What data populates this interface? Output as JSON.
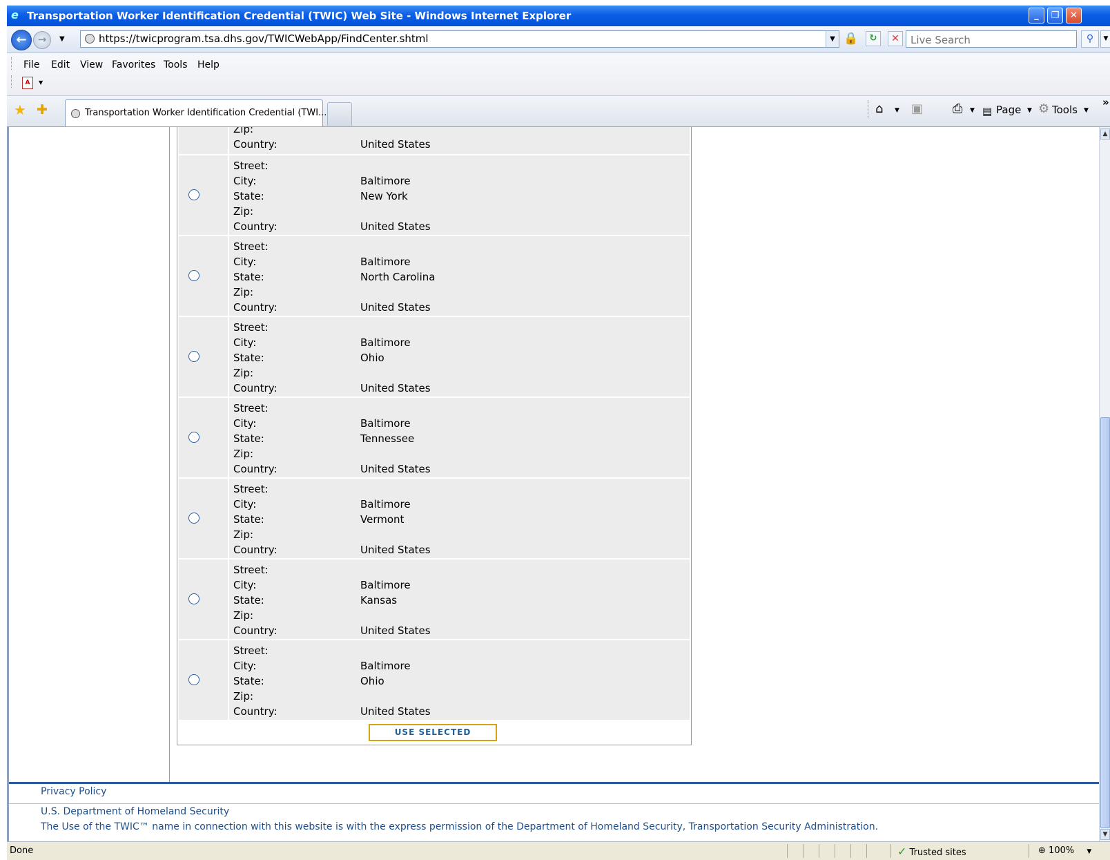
{
  "window": {
    "title": "Transportation Worker Identification Credential (TWIC) Web Site - Windows Internet Explorer"
  },
  "address_bar": {
    "url": "https://twicprogram.tsa.dhs.gov/TWICWebApp/FindCenter.shtml",
    "search_placeholder": "Live Search"
  },
  "menu": [
    "File",
    "Edit",
    "View",
    "Favorites",
    "Tools",
    "Help"
  ],
  "tab": {
    "label": "Transportation Worker Identification Credential (TWI..."
  },
  "command_bar": {
    "page_label": "Page",
    "tools_label": "Tools",
    "chevron": "»"
  },
  "labels": {
    "street": "Street:",
    "city": "City:",
    "state": "State:",
    "zip": "Zip:",
    "country": "Country:"
  },
  "partial_row": {
    "zip": "",
    "country": "United States"
  },
  "locations": [
    {
      "street": "",
      "city": "Baltimore",
      "state": "New York",
      "zip": "",
      "country": "United States"
    },
    {
      "street": "",
      "city": "Baltimore",
      "state": "North Carolina",
      "zip": "",
      "country": "United States"
    },
    {
      "street": "",
      "city": "Baltimore",
      "state": "Ohio",
      "zip": "",
      "country": "United States"
    },
    {
      "street": "",
      "city": "Baltimore",
      "state": "Tennessee",
      "zip": "",
      "country": "United States"
    },
    {
      "street": "",
      "city": "Baltimore",
      "state": "Vermont",
      "zip": "",
      "country": "United States"
    },
    {
      "street": "",
      "city": "Baltimore",
      "state": "Kansas",
      "zip": "",
      "country": "United States"
    },
    {
      "street": "",
      "city": "Baltimore",
      "state": "Ohio",
      "zip": "",
      "country": "United States"
    }
  ],
  "use_selected_label": "USE SELECTED",
  "footer": {
    "privacy": "Privacy Policy",
    "dept": "U.S. Department of Homeland Security",
    "note": "The Use of the TWIC™ name in connection with this website is with the express permission of the Department of Homeland Security, Transportation Security Administration."
  },
  "status": {
    "text": "Done",
    "zone": "Trusted sites",
    "zoom": "100%"
  },
  "colors": {
    "titlebar": "#0b5ee6",
    "row_background": "#ececec",
    "link": "#1f4f8a",
    "button_border": "#d4a317",
    "footer_rule": "#2a5ea0"
  }
}
